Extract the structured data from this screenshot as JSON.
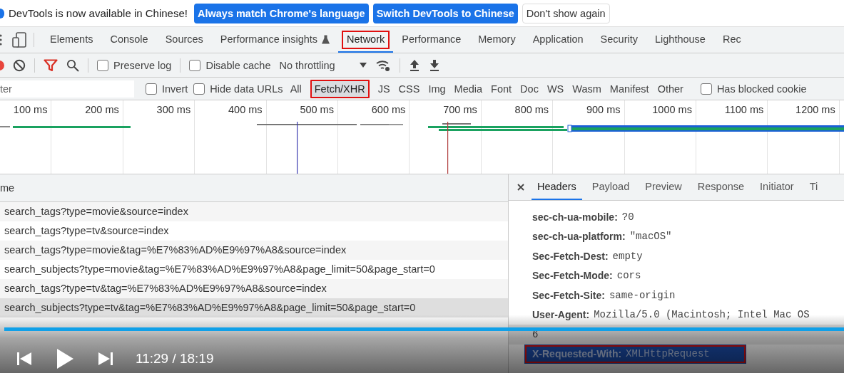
{
  "infobar": {
    "message": "DevTools is now available in Chinese!",
    "buttons": [
      {
        "label": "Always match Chrome's language",
        "kind": "primary"
      },
      {
        "label": "Switch DevTools to Chinese",
        "kind": "primary"
      },
      {
        "label": "Don't show again",
        "kind": "secondary"
      }
    ]
  },
  "panel_tabs": [
    {
      "label": "Elements",
      "selected": false,
      "highlighted": false
    },
    {
      "label": "Console",
      "selected": false,
      "highlighted": false
    },
    {
      "label": "Sources",
      "selected": false,
      "highlighted": false
    },
    {
      "label": "Performance insights",
      "selected": false,
      "highlighted": false,
      "experimental": true
    },
    {
      "label": "Network",
      "selected": true,
      "highlighted": true
    },
    {
      "label": "Performance",
      "selected": false,
      "highlighted": false
    },
    {
      "label": "Memory",
      "selected": false,
      "highlighted": false
    },
    {
      "label": "Application",
      "selected": false,
      "highlighted": false
    },
    {
      "label": "Security",
      "selected": false,
      "highlighted": false
    },
    {
      "label": "Lighthouse",
      "selected": false,
      "highlighted": false
    },
    {
      "label": "Rec",
      "selected": false,
      "highlighted": false
    }
  ],
  "toolbar": {
    "preserve_log": {
      "label": "Preserve log",
      "checked": false
    },
    "disable_cache": {
      "label": "Disable cache",
      "checked": false
    },
    "throttling": "No throttling"
  },
  "filter_bar": {
    "placeholder": "ter",
    "invert": {
      "label": "Invert",
      "checked": false
    },
    "hide_data_urls": {
      "label": "Hide data URLs",
      "checked": false
    },
    "types": [
      {
        "label": "All",
        "selected": false,
        "highlighted": false
      },
      {
        "label": "Fetch/XHR",
        "selected": true,
        "highlighted": true
      },
      {
        "label": "JS",
        "selected": false,
        "highlighted": false
      },
      {
        "label": "CSS",
        "selected": false,
        "highlighted": false
      },
      {
        "label": "Img",
        "selected": false,
        "highlighted": false
      },
      {
        "label": "Media",
        "selected": false,
        "highlighted": false
      },
      {
        "label": "Font",
        "selected": false,
        "highlighted": false
      },
      {
        "label": "Doc",
        "selected": false,
        "highlighted": false
      },
      {
        "label": "WS",
        "selected": false,
        "highlighted": false
      },
      {
        "label": "Wasm",
        "selected": false,
        "highlighted": false
      },
      {
        "label": "Manifest",
        "selected": false,
        "highlighted": false
      },
      {
        "label": "Other",
        "selected": false,
        "highlighted": false
      }
    ],
    "blocked_cookies": {
      "label": "Has blocked cookie",
      "checked": false
    }
  },
  "timeline": {
    "ticks": [
      "100 ms",
      "200 ms",
      "300 ms",
      "400 ms",
      "500 ms",
      "600 ms",
      "700 ms",
      "800 ms",
      "900 ms",
      "1000 ms",
      "1100 ms",
      "1200 ms"
    ]
  },
  "requests": {
    "column": "me",
    "rows": [
      {
        "name": "search_tags?type=movie&source=index",
        "selected": false
      },
      {
        "name": "search_tags?type=tv&source=index",
        "selected": false
      },
      {
        "name": "search_tags?type=movie&tag=%E7%83%AD%E9%97%A8&source=index",
        "selected": false
      },
      {
        "name": "search_subjects?type=movie&tag=%E7%83%AD%E9%97%A8&page_limit=50&page_start=0",
        "selected": false
      },
      {
        "name": "search_tags?type=tv&tag=%E7%83%AD%E9%97%A8&source=index",
        "selected": false
      },
      {
        "name": "search_subjects?type=tv&tag=%E7%83%AD%E9%97%A8&page_limit=50&page_start=0",
        "selected": true
      }
    ]
  },
  "details": {
    "tabs": [
      {
        "label": "Headers",
        "selected": true
      },
      {
        "label": "Payload",
        "selected": false
      },
      {
        "label": "Preview",
        "selected": false
      },
      {
        "label": "Response",
        "selected": false
      },
      {
        "label": "Initiator",
        "selected": false
      },
      {
        "label": "Ti",
        "selected": false
      }
    ],
    "headers": [
      {
        "name": "sec-ch-ua-mobile:",
        "value": "?0",
        "selected": false,
        "highlighted": false
      },
      {
        "name": "sec-ch-ua-platform:",
        "value": "\"macOS\"",
        "selected": false,
        "highlighted": false
      },
      {
        "name": "Sec-Fetch-Dest:",
        "value": "empty",
        "selected": false,
        "highlighted": false
      },
      {
        "name": "Sec-Fetch-Mode:",
        "value": "cors",
        "selected": false,
        "highlighted": false
      },
      {
        "name": "Sec-Fetch-Site:",
        "value": "same-origin",
        "selected": false,
        "highlighted": false
      },
      {
        "name": "User-Agent:",
        "value": "Mozilla/5.0 (Macintosh; Intel Mac OS",
        "selected": false,
        "highlighted": false
      },
      {
        "value": "6",
        "selected": false,
        "highlighted": false
      },
      {
        "name": "X-Requested-With:",
        "value": "XMLHttpRequest",
        "selected": true,
        "highlighted": true
      }
    ]
  },
  "video_player": {
    "time": "11:29 / 18:19",
    "level": 1
  }
}
